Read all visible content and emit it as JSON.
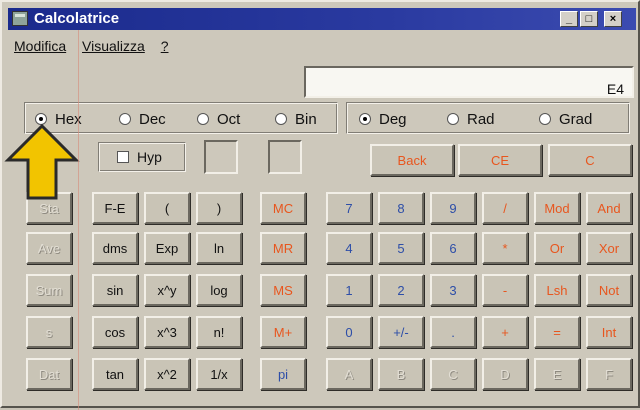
{
  "window": {
    "title": "Calcolatrice",
    "buttons": {
      "minimize": "_",
      "maximize": "□",
      "close": "×"
    }
  },
  "menu": [
    "Modifica",
    "Visualizza",
    "?"
  ],
  "display": {
    "value": "E4"
  },
  "base": {
    "options": [
      "Hex",
      "Dec",
      "Oct",
      "Bin"
    ],
    "selected": "Hex"
  },
  "angle": {
    "options": [
      "Deg",
      "Rad",
      "Grad"
    ],
    "selected": "Deg"
  },
  "hyp": {
    "label": "Hyp"
  },
  "row_edit": {
    "back": "Back",
    "ce": "CE",
    "c": "C"
  },
  "stats": [
    "Sta",
    "Ave",
    "Sum",
    "s",
    "Dat"
  ],
  "sci_col1": [
    "F-E",
    "dms",
    "sin",
    "cos",
    "tan"
  ],
  "sci_col2": [
    "(",
    "Exp",
    "x^y",
    "x^3",
    "x^2"
  ],
  "sci_col3": [
    ")",
    "ln",
    "log",
    "n!",
    "1/x"
  ],
  "memory": [
    "MC",
    "MR",
    "MS",
    "M+",
    "pi"
  ],
  "digits": {
    "r1": [
      "7",
      "8",
      "9",
      "/",
      "Mod",
      "And"
    ],
    "r2": [
      "4",
      "5",
      "6",
      "*",
      "Or",
      "Xor"
    ],
    "r3": [
      "1",
      "2",
      "3",
      "-",
      "Lsh",
      "Not"
    ],
    "r4": [
      "0",
      "+/-",
      ".",
      "+",
      "=",
      "Int"
    ],
    "r5": [
      "A",
      "B",
      "C",
      "D",
      "E",
      "F"
    ]
  },
  "colors": {
    "title_bar": "#1a2a8c",
    "red_label": "#e8561e",
    "blue_label": "#2d4ea8",
    "arrow": "#f2c400"
  }
}
